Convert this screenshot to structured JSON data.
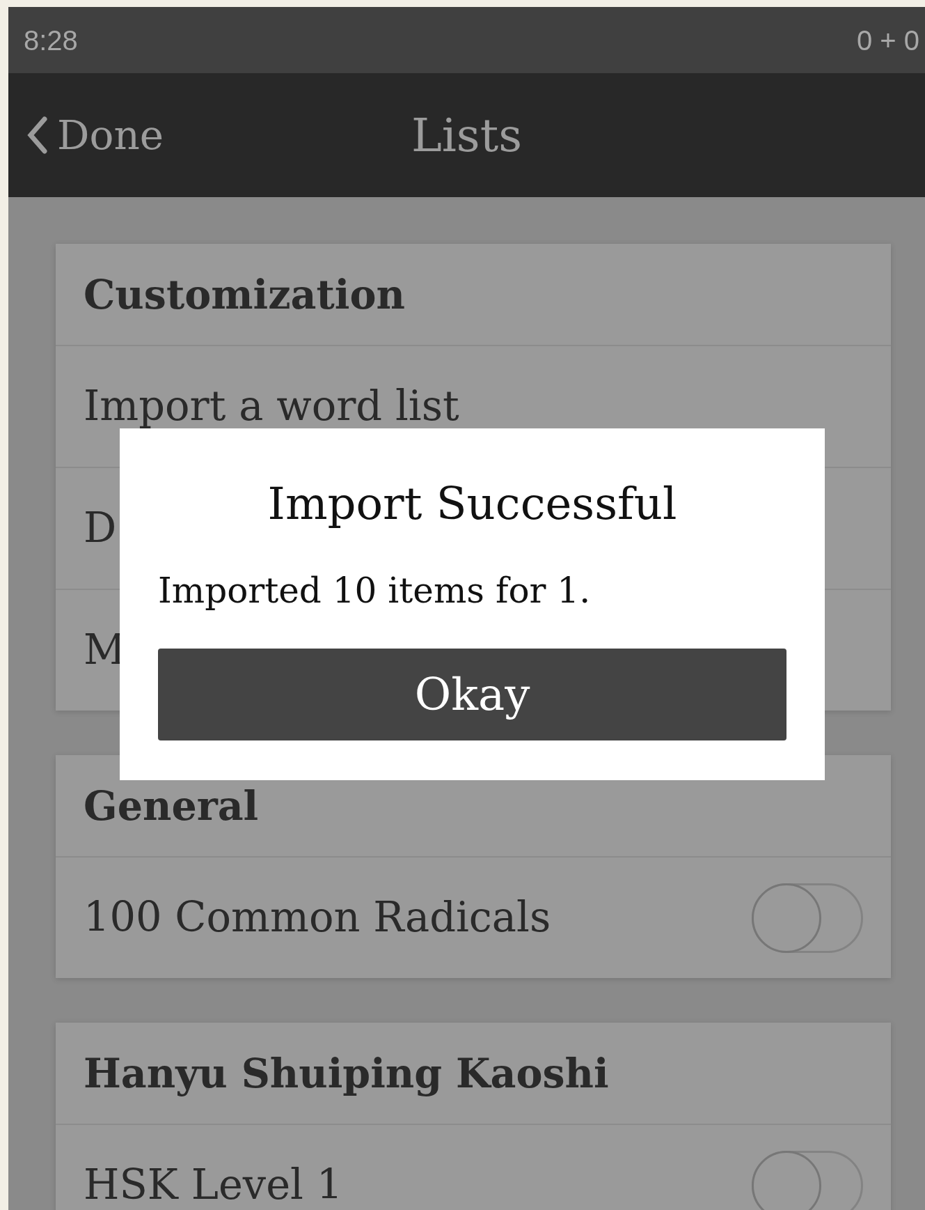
{
  "status_bar": {
    "time": "8:28",
    "counter": "0 + 0"
  },
  "nav": {
    "back": "Done",
    "title": "Lists"
  },
  "sections": [
    {
      "title": "Customization",
      "items": [
        {
          "kind": "link",
          "label": "Import a word list"
        },
        {
          "kind": "link",
          "label": "D"
        },
        {
          "kind": "link",
          "label": "M"
        }
      ]
    },
    {
      "title": "General",
      "items": [
        {
          "kind": "toggle",
          "label": "100 Common Radicals",
          "on": false
        }
      ]
    },
    {
      "title": "Hanyu Shuiping Kaoshi",
      "items": [
        {
          "kind": "toggle",
          "label": "HSK Level 1",
          "on": false
        }
      ]
    }
  ],
  "dialog": {
    "title": "Import Successful",
    "message": "Imported 10 items for 1.",
    "button": "Okay"
  }
}
